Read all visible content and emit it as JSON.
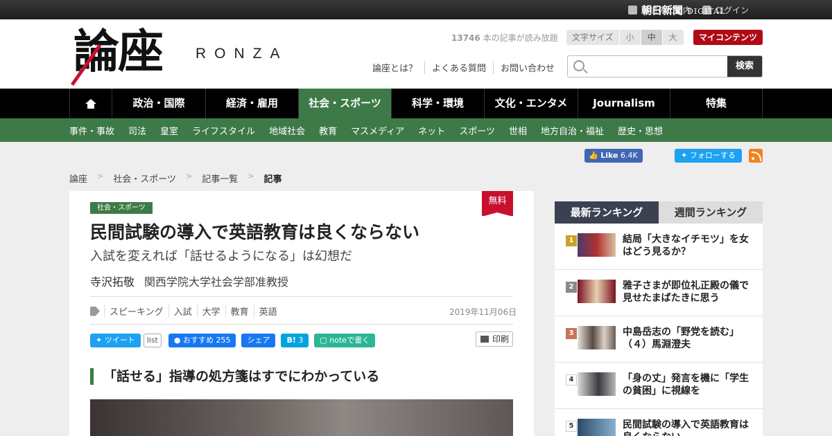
{
  "topbar": {
    "subscribe_label": "購読のご案内",
    "login_label": "ログイン",
    "brand": "朝日新聞",
    "brand_sub": "DIGITAL"
  },
  "header": {
    "logo": "論座",
    "logo_sub": "RONZA",
    "count_number": "13746",
    "count_text": " 本の記事が読み放題",
    "font_size_label": "文字サイズ",
    "font_sizes": [
      "小",
      "中",
      "大"
    ],
    "font_size_selected": "中",
    "mycontent_label": "マイコンテンツ",
    "links": [
      "論座とは？",
      "よくある質問",
      "お問い合わせ"
    ],
    "search_placeholder": "",
    "search_button": "検索"
  },
  "mainnav": {
    "items": [
      "政治・国際",
      "経済・雇用",
      "社会・スポーツ",
      "科学・環境",
      "文化・エンタメ",
      "Journalism",
      "特集"
    ],
    "active": "社会・スポーツ"
  },
  "subnav": {
    "items": [
      "事件・事故",
      "司法",
      "皇室",
      "ライフスタイル",
      "地域社会",
      "教育",
      "マスメディア",
      "ネット",
      "スポーツ",
      "世相",
      "地方自治・福祉",
      "歴史・思想"
    ]
  },
  "social": {
    "fb_like": "Like",
    "fb_like_count": "6.4K",
    "tw_follow": "フォローする"
  },
  "breadcrumb": [
    "論座",
    "社会・スポーツ",
    "記事一覧",
    "記事"
  ],
  "breadcrumb_sep": ">",
  "article": {
    "category": "社会・スポーツ",
    "free_badge": "無料",
    "title": "民間試験の導入で英語教育は良くならない",
    "subtitle": "入試を変えれば「話せるようになる」は幻想だ",
    "author": "寺沢拓敬",
    "author_role": "関西学院大学社会学部准教授",
    "tags": [
      "スピーキング",
      "入試",
      "大学",
      "教育",
      "英語"
    ],
    "date": "2019年11月06日",
    "share": {
      "tweet": "ツイート",
      "list": "list",
      "fb_recommend": "おすすめ",
      "fb_count": "255",
      "fb_share": "シェア",
      "hatena": "B!",
      "hatena_count": "3",
      "note": "noteで書く",
      "print": "印刷"
    },
    "heading": "「話せる」指導の処方箋はすでにわかっている"
  },
  "ranking": {
    "tabs": [
      "最新ランキング",
      "週間ランキング"
    ],
    "active_tab": "最新ランキング",
    "items": [
      {
        "rank": "1",
        "text": "結局「大きなイチモツ」を女はどう見るか？"
      },
      {
        "rank": "2",
        "text": "雅子さまが即位礼正殿の儀で見せたまばたきに思う"
      },
      {
        "rank": "3",
        "text": "中島岳志の「野党を読む」（４）馬淵澄夫"
      },
      {
        "rank": "4",
        "text": "「身の丈」発言を機に「学生の貧困」に視線を"
      },
      {
        "rank": "5",
        "text": "民間試験の導入で英語教育は良くならない"
      }
    ]
  },
  "colors": {
    "accent_green": "#3d7a47",
    "brand_red": "#c8102e",
    "nav_black": "#000000",
    "ranking_tab": "#3b4150"
  }
}
